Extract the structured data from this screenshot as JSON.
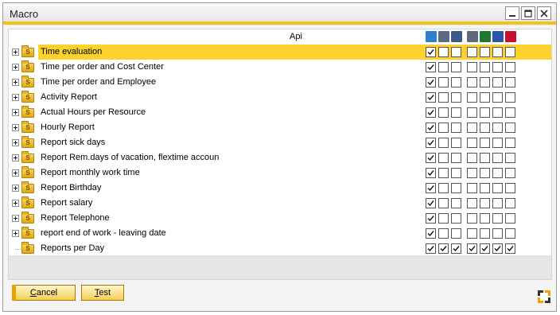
{
  "window": {
    "title": "Macro",
    "controls": [
      "minimize",
      "maximize",
      "close"
    ]
  },
  "grid": {
    "column_header": "Api",
    "header_icons": [
      {
        "name": "preview-icon",
        "color": "#2f7fd1"
      },
      {
        "name": "print-icon",
        "color": "#5a6b88"
      },
      {
        "name": "email-icon",
        "color": "#3b5a8a"
      },
      {
        "name": "calculator-icon",
        "color": "#5f6b78"
      },
      {
        "name": "excel-icon",
        "color": "#1e7a30"
      },
      {
        "name": "word-icon",
        "color": "#2a57a8"
      },
      {
        "name": "pdf-icon",
        "color": "#c8102e"
      }
    ],
    "rows": [
      {
        "label": "Time evaluation",
        "expandable": true,
        "selected": true,
        "checks": [
          true,
          false,
          false,
          false,
          false,
          false,
          false
        ]
      },
      {
        "label": "Time per order and Cost Center",
        "expandable": true,
        "selected": false,
        "checks": [
          true,
          false,
          false,
          false,
          false,
          false,
          false
        ]
      },
      {
        "label": "Time per order and Employee",
        "expandable": true,
        "selected": false,
        "checks": [
          true,
          false,
          false,
          false,
          false,
          false,
          false
        ]
      },
      {
        "label": "Activity Report",
        "expandable": true,
        "selected": false,
        "checks": [
          true,
          false,
          false,
          false,
          false,
          false,
          false
        ]
      },
      {
        "label": "Actual Hours per Resource",
        "expandable": true,
        "selected": false,
        "checks": [
          true,
          false,
          false,
          false,
          false,
          false,
          false
        ]
      },
      {
        "label": "Hourly Report",
        "expandable": true,
        "selected": false,
        "checks": [
          true,
          false,
          false,
          false,
          false,
          false,
          false
        ]
      },
      {
        "label": "Report sick days",
        "expandable": true,
        "selected": false,
        "checks": [
          true,
          false,
          false,
          false,
          false,
          false,
          false
        ]
      },
      {
        "label": "Report Rem.days of vacation, flextime accoun",
        "expandable": true,
        "selected": false,
        "checks": [
          true,
          false,
          false,
          false,
          false,
          false,
          false
        ]
      },
      {
        "label": "Report monthly work time",
        "expandable": true,
        "selected": false,
        "checks": [
          true,
          false,
          false,
          false,
          false,
          false,
          false
        ]
      },
      {
        "label": "Report Birthday",
        "expandable": true,
        "selected": false,
        "checks": [
          true,
          false,
          false,
          false,
          false,
          false,
          false
        ]
      },
      {
        "label": "Report salary",
        "expandable": true,
        "selected": false,
        "checks": [
          true,
          false,
          false,
          false,
          false,
          false,
          false
        ]
      },
      {
        "label": "Report Telephone",
        "expandable": true,
        "selected": false,
        "checks": [
          true,
          false,
          false,
          false,
          false,
          false,
          false
        ]
      },
      {
        "label": "report end of work - leaving date",
        "expandable": true,
        "selected": false,
        "checks": [
          true,
          false,
          false,
          false,
          false,
          false,
          false
        ]
      },
      {
        "label": "Reports per Day",
        "expandable": false,
        "selected": false,
        "checks": [
          true,
          true,
          true,
          true,
          true,
          true,
          true
        ]
      }
    ]
  },
  "buttons": {
    "cancel": {
      "mnemonic": "C",
      "rest": "ancel"
    },
    "test": {
      "mnemonic": "T",
      "rest": "est"
    }
  },
  "colors": {
    "accent": "#f4c318",
    "selection": "#fdd12e"
  }
}
